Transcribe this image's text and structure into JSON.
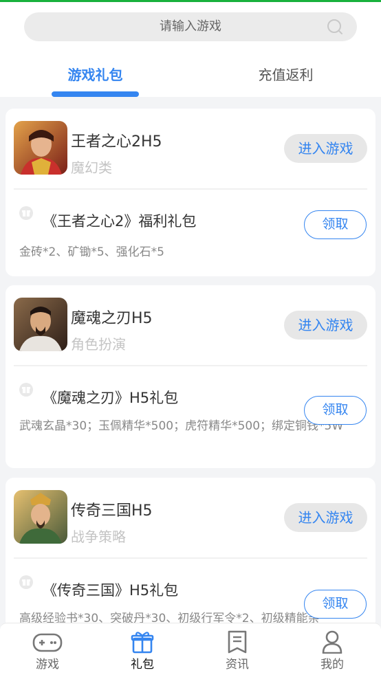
{
  "search": {
    "placeholder": "请输入游戏"
  },
  "tabs": [
    {
      "label": "游戏礼包",
      "active": true
    },
    {
      "label": "充值返利",
      "active": false
    }
  ],
  "cards": [
    {
      "name": "王者之心2H5",
      "category": "魔幻类",
      "enter_label": "进入游戏",
      "gift_title": "《王者之心2》福利礼包",
      "gift_desc": "金砖*2、矿锄*5、强化石*5",
      "claim_label": "领取",
      "icon_color": "#b8442e"
    },
    {
      "name": "魔魂之刃H5",
      "category": "角色扮演",
      "enter_label": "进入游戏",
      "gift_title": "《魔魂之刃》H5礼包",
      "gift_desc": "武魂玄晶*30；玉佩精华*500；虎符精华*500；绑定铜钱*5W",
      "claim_label": "领取",
      "icon_color": "#6a5040"
    },
    {
      "name": "传奇三国H5",
      "category": "战争策略",
      "enter_label": "进入游戏",
      "gift_title": "《传奇三国》H5礼包",
      "gift_desc": "高级经验书*30、突破丹*30、初级行军令*2、初级精能亲",
      "claim_label": "领取",
      "icon_color": "#c79a3a"
    }
  ],
  "nav": [
    {
      "label": "游戏",
      "icon": "gamepad-icon",
      "active": false
    },
    {
      "label": "礼包",
      "icon": "gift-icon",
      "active": true
    },
    {
      "label": "资讯",
      "icon": "document-icon",
      "active": false
    },
    {
      "label": "我的",
      "icon": "user-icon",
      "active": false
    }
  ],
  "colors": {
    "accent": "#3485f0",
    "topline": "#19b13d"
  }
}
